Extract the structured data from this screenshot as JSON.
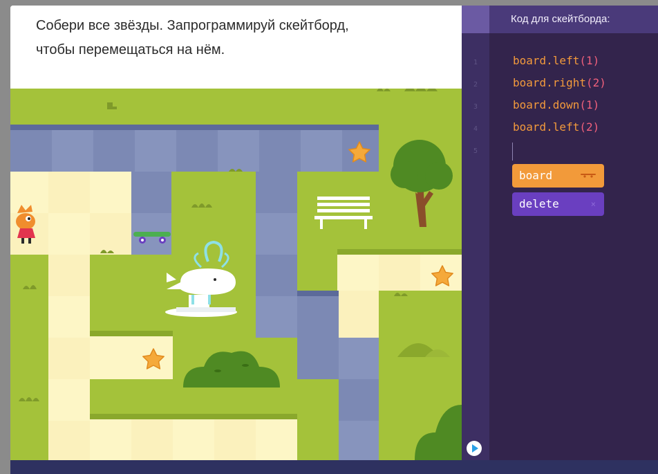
{
  "task": {
    "line1": "Собери все звёзды. Запрограммируй скейтборд,",
    "line2": "чтобы перемещаться на нём."
  },
  "editor": {
    "title": "Код для скейтборда:",
    "line_numbers": [
      "1",
      "2",
      "3",
      "4",
      "5"
    ],
    "code": [
      {
        "obj": "board.",
        "method": "left",
        "arg": "(1)"
      },
      {
        "obj": "board.",
        "method": "right",
        "arg": "(2)"
      },
      {
        "obj": "board.",
        "method": "down",
        "arg": "(1)"
      },
      {
        "obj": "board.",
        "method": "left",
        "arg": "(2)"
      }
    ],
    "snippets": [
      {
        "label": "board",
        "icon": "skateboard-icon"
      },
      {
        "label": "delete",
        "icon": "close-icon",
        "icon_glyph": "×"
      }
    ],
    "run_icon": "play-icon"
  },
  "colors": {
    "grass": "#a4c23a",
    "path_blue": "#7c89b4",
    "path_cream": "#fdf6c6",
    "star": "#f5a93a",
    "snippet_board": "#f29a3a",
    "snippet_delete": "#6a3fc0",
    "editor_bg": "#33244c"
  }
}
